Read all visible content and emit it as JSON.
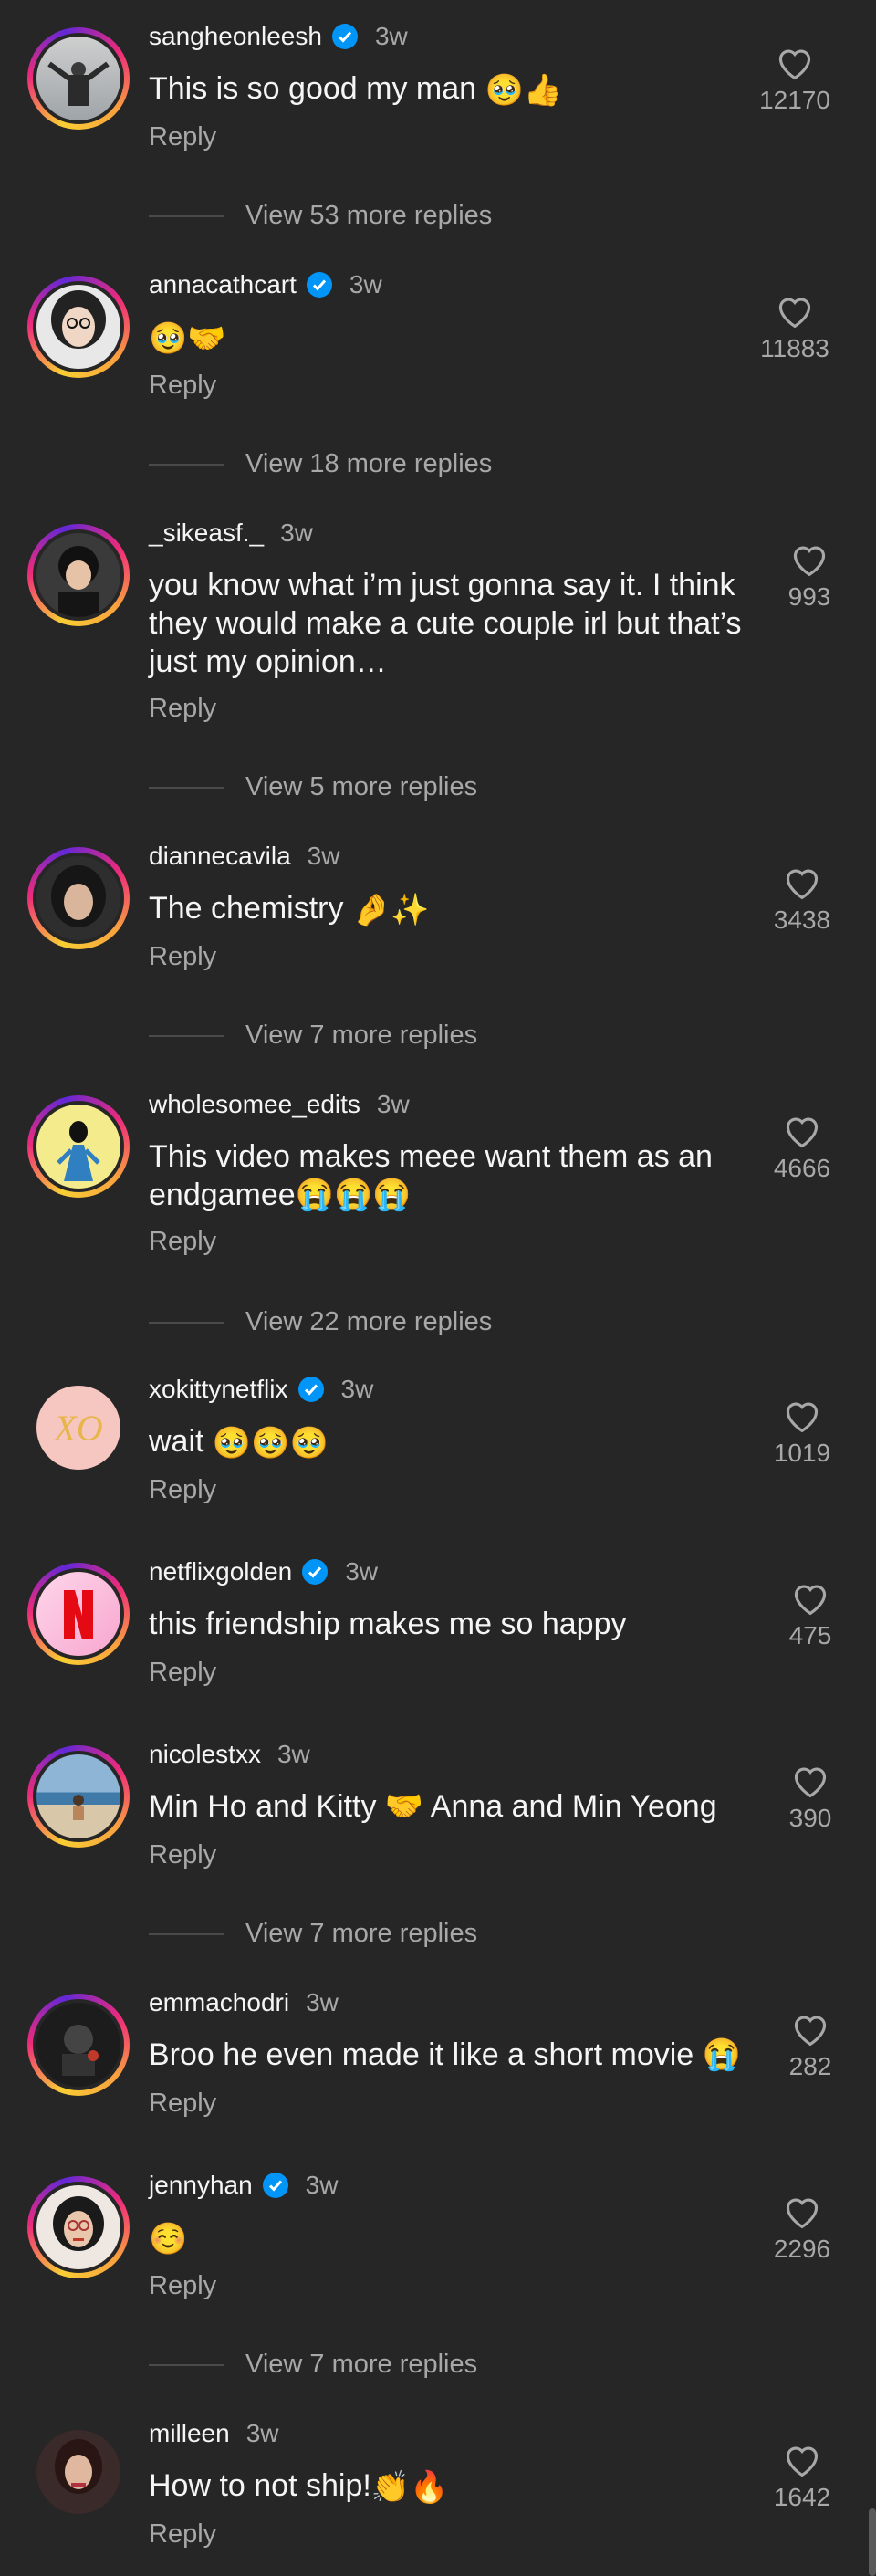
{
  "comments": [
    {
      "username": "sangheonleesh",
      "verified": true,
      "time": "3w",
      "text": "This is so good my man",
      "emojis": "🥹👍",
      "reply": "Reply",
      "likes": "12170",
      "view_more": "View 53 more replies"
    },
    {
      "username": "annacathcart",
      "verified": true,
      "time": "3w",
      "text": "",
      "emojis": "🥹🤝",
      "reply": "Reply",
      "likes": "11883",
      "view_more": "View 18 more replies"
    },
    {
      "username": "_sikeasf._",
      "verified": false,
      "time": "3w",
      "text_lines": [
        "you know what i’m just gonna say it. I think",
        "they would make a cute couple irl but that’s",
        "just my opinion…"
      ],
      "reply": "Reply",
      "likes": "993",
      "view_more": "View 5 more replies"
    },
    {
      "username": "diannecavila",
      "verified": false,
      "time": "3w",
      "text": "The chemistry",
      "emojis": "🤌✨",
      "reply": "Reply",
      "likes": "3438",
      "view_more": "View 7 more replies"
    },
    {
      "username": "wholesomee_edits",
      "verified": false,
      "time": "3w",
      "text_lines": [
        "This video makes meee want them as an",
        "endgamee😭😭😭"
      ],
      "reply": "Reply",
      "likes": "4666",
      "view_more": "View 22 more replies"
    },
    {
      "username": "xokittynetflix",
      "verified": true,
      "time": "3w",
      "text": "wait",
      "emojis": "🥹🥹🥹",
      "reply": "Reply",
      "likes": "1019"
    },
    {
      "username": "netflixgolden",
      "verified": true,
      "time": "3w",
      "text": "this friendship makes me so happy",
      "reply": "Reply",
      "likes": "475"
    },
    {
      "username": "nicolestxx",
      "verified": false,
      "time": "3w",
      "text": "Min Ho and Kitty 🤝 Anna and Min Yeong",
      "reply": "Reply",
      "likes": "390",
      "view_more": "View 7 more replies"
    },
    {
      "username": "emmachodri",
      "verified": false,
      "time": "3w",
      "text": "Broo he even made it like a short movie 😭",
      "reply": "Reply",
      "likes": "282"
    },
    {
      "username": "jennyhan",
      "verified": true,
      "time": "3w",
      "text": "",
      "emojis": "☺️",
      "reply": "Reply",
      "likes": "2296",
      "view_more": "View 7 more replies"
    },
    {
      "username": "milleen",
      "verified": false,
      "time": "3w",
      "text": "How to not ship!",
      "emojis": "👏🔥",
      "reply": "Reply",
      "likes": "1642"
    }
  ],
  "colors": {
    "background": "#262626",
    "secondary_text": "#a8a8a8",
    "verified": "#0095f6"
  }
}
